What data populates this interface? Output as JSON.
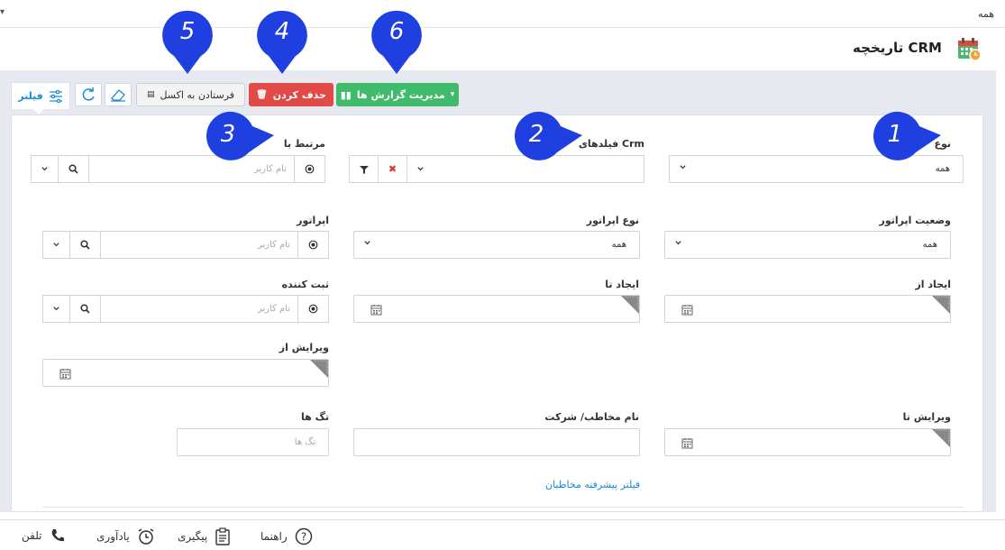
{
  "topbar": {
    "all_label": "همه"
  },
  "header": {
    "title": "تاریخچه CRM"
  },
  "toolbar": {
    "manage_reports": "مدیریت گزارش ها",
    "delete": "حذف کردن",
    "export_excel": "فرستادن به اکسل",
    "filter_tab": "فیلتر"
  },
  "callouts": [
    "1",
    "2",
    "3",
    "4",
    "5",
    "6"
  ],
  "form": {
    "type": {
      "label": "نوع",
      "value": "همه"
    },
    "crm_fields": {
      "label": "فیلدهای Crm"
    },
    "related_to": {
      "label": "مرتبط با",
      "placeholder": "نام کاربر"
    },
    "operator_status": {
      "label": "وضعیت اپراتور",
      "value": "همه"
    },
    "operator_type": {
      "label": "نوع اپراتور",
      "value": "همه"
    },
    "operator": {
      "label": "اپراتور",
      "placeholder": "نام کاربر"
    },
    "created_from": {
      "label": "ایجاد از"
    },
    "created_to": {
      "label": "ایجاد تا"
    },
    "registrar": {
      "label": "ثبت کننده",
      "placeholder": "نام کاربر"
    },
    "edited_from": {
      "label": "ویرایش از"
    },
    "edited_to": {
      "label": "ویرایش تا"
    },
    "contact_company": {
      "label": "نام مخاطب/ شرکت"
    },
    "tags": {
      "label": "تگ ها",
      "placeholder": "تگ ها"
    },
    "advanced_filter": "فیلتر پیشرفته مخاطبان"
  },
  "bottombar": {
    "phone": "تلفن",
    "reminder": "یادآوری",
    "followup": "پیگیری",
    "help": "راهنما"
  },
  "colors": {
    "accent": "#1a8bd6",
    "green": "#3fbb6b",
    "red": "#e24a4a",
    "callout": "#1f3fe0"
  }
}
